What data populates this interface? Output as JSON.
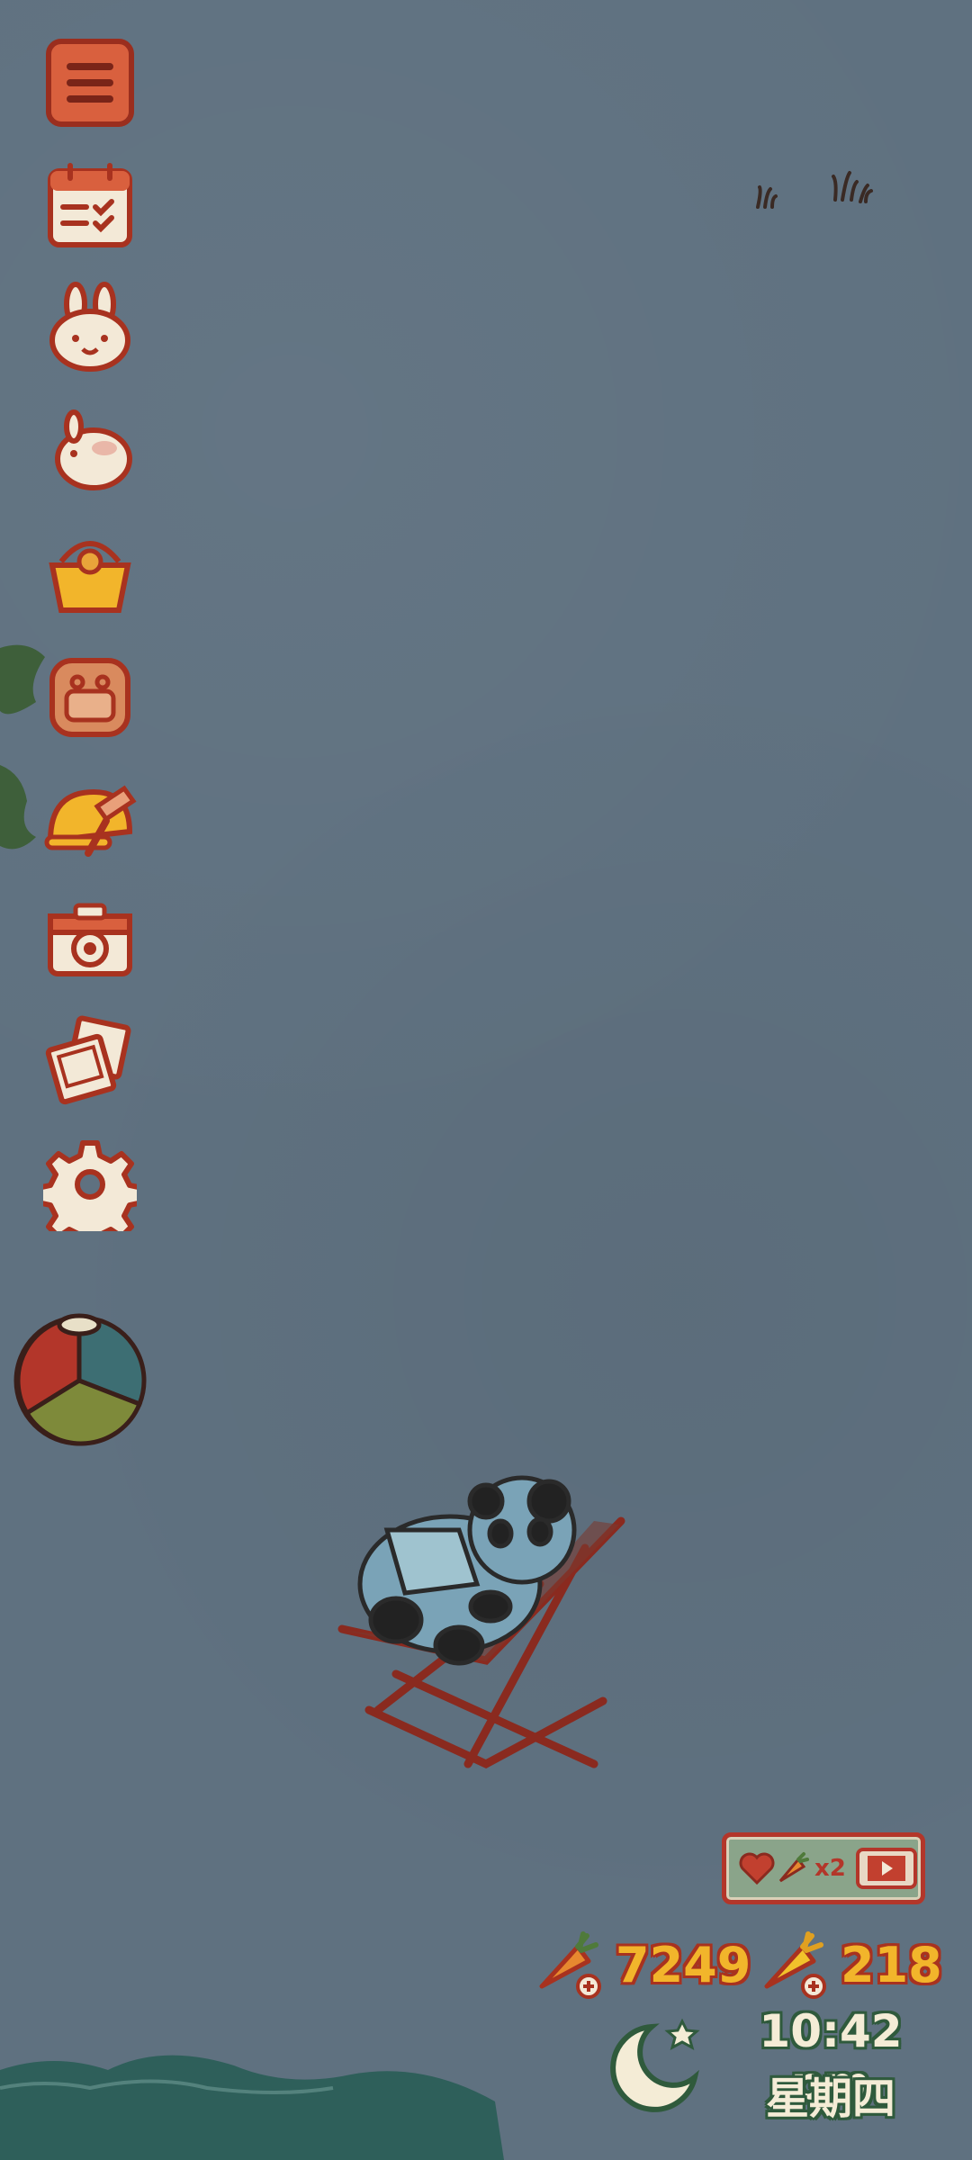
{
  "sidebar": {
    "items": [
      {
        "icon": "menu-icon"
      },
      {
        "icon": "calendar-tasks-icon"
      },
      {
        "icon": "bunny-face-icon"
      },
      {
        "icon": "bunny-collection-icon"
      },
      {
        "icon": "basket-icon"
      },
      {
        "icon": "backpack-icon"
      },
      {
        "icon": "build-hammer-icon"
      },
      {
        "icon": "camera-icon"
      },
      {
        "icon": "photo-album-icon"
      },
      {
        "icon": "settings-gear-icon"
      }
    ]
  },
  "bonus": {
    "label": "x2",
    "icons": [
      "heart-icon",
      "carrot-icon",
      "video-play-icon"
    ]
  },
  "currency": {
    "carrots": "7249",
    "gold_carrots": "218"
  },
  "clock": {
    "time": "10:42 pm",
    "day": "星期四",
    "icon": "moon-star-icon"
  },
  "colors": {
    "background": "#5f7180",
    "accent_red": "#b3362a",
    "cream": "#f4ecd6",
    "gold": "#f2b52b",
    "clock_outline": "#2f5a3c"
  }
}
